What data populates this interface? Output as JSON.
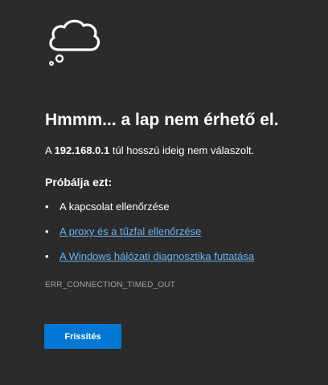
{
  "error": {
    "title": "Hmmm... a lap nem érhető el.",
    "message_prefix": "A ",
    "host": "192.168.0.1",
    "message_suffix": " túl hosszú ideig nem válaszolt.",
    "try_heading": "Próbálja ezt:",
    "suggestions": [
      {
        "text": "A kapcsolat ellenőrzése",
        "is_link": false
      },
      {
        "text": "A proxy és a tűzfal ellenőrzése",
        "is_link": true
      },
      {
        "text": "A Windows hálózati diagnosztika futtatása",
        "is_link": true
      }
    ],
    "code": "ERR_CONNECTION_TIMED_OUT",
    "icon": "thought-cloud-icon"
  },
  "actions": {
    "refresh_label": "Frissítés"
  },
  "colors": {
    "background": "#2b2b2b",
    "link": "#6cb3f3",
    "button": "#0078d4",
    "muted_text": "#a6a6a6"
  }
}
